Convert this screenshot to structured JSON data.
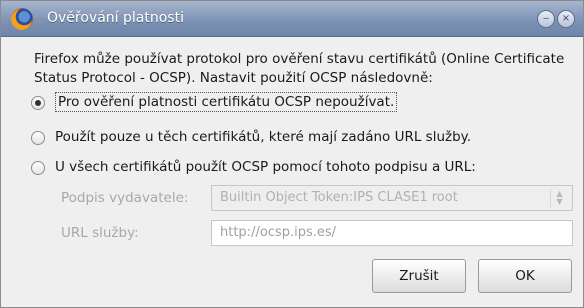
{
  "window": {
    "title": "Ověřování platnosti",
    "minimize_symbol": "‒",
    "close_symbol": "×",
    "app_icon": "firefox-icon"
  },
  "description": "Firefox může používat protokol pro ověření stavu certifikátů (Online Certificate Status Protocol - OCSP). Nastavit použití OCSP následovně:",
  "options": [
    {
      "label": "Pro ověření platnosti certifikátu OCSP nepoužívat.",
      "checked": true
    },
    {
      "label": "Použít pouze u těch certifikátů, které mají zadáno URL služby.",
      "checked": false
    },
    {
      "label": "U všech certifikátů použít OCSP pomocí tohoto podpisu a URL:",
      "checked": false
    }
  ],
  "signer": {
    "label": "Podpis vydavatele:",
    "value": "Builtin Object Token:IPS CLASE1 root",
    "enabled": false
  },
  "service_url": {
    "label": "URL služby:",
    "value": "http://ocsp.ips.es/",
    "enabled": false
  },
  "buttons": {
    "cancel": "Zrušit",
    "ok": "OK"
  }
}
